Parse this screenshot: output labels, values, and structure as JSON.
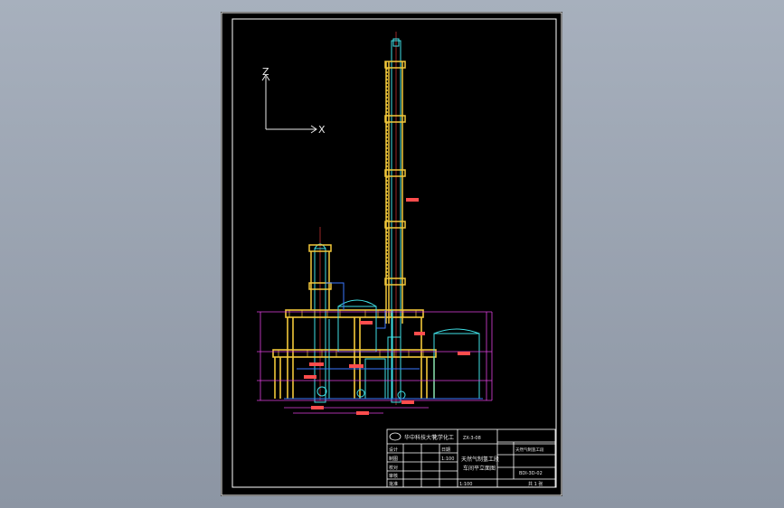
{
  "axis": {
    "z_label": "Z",
    "x_label": "X"
  },
  "title_block": {
    "university": "华中科技大学",
    "department": "化学化工",
    "code_top": "ZX-3-08",
    "drawing_title_line1": "天然气制氢工段",
    "drawing_title_line2": "车间平立面图",
    "project": "天然气制氢工段",
    "drawing_no": "BDI-3D-02",
    "scale": "1:100",
    "sheet": "共 1 张",
    "rows": [
      [
        "设计",
        "",
        "日期"
      ],
      [
        "制图",
        "",
        "1:100"
      ],
      [
        "校对",
        "",
        ""
      ],
      [
        "审核",
        "",
        ""
      ],
      [
        "批准",
        "",
        ""
      ]
    ]
  },
  "colors": {
    "sheet": "#000000",
    "frame": "#ffffff",
    "structure": "#f2c83a",
    "equipment": "#3fe0e6",
    "dimension": "#e040e0",
    "pipe": "#3a78ff",
    "centerline": "#ff4040",
    "label": "#ff4d4d"
  }
}
